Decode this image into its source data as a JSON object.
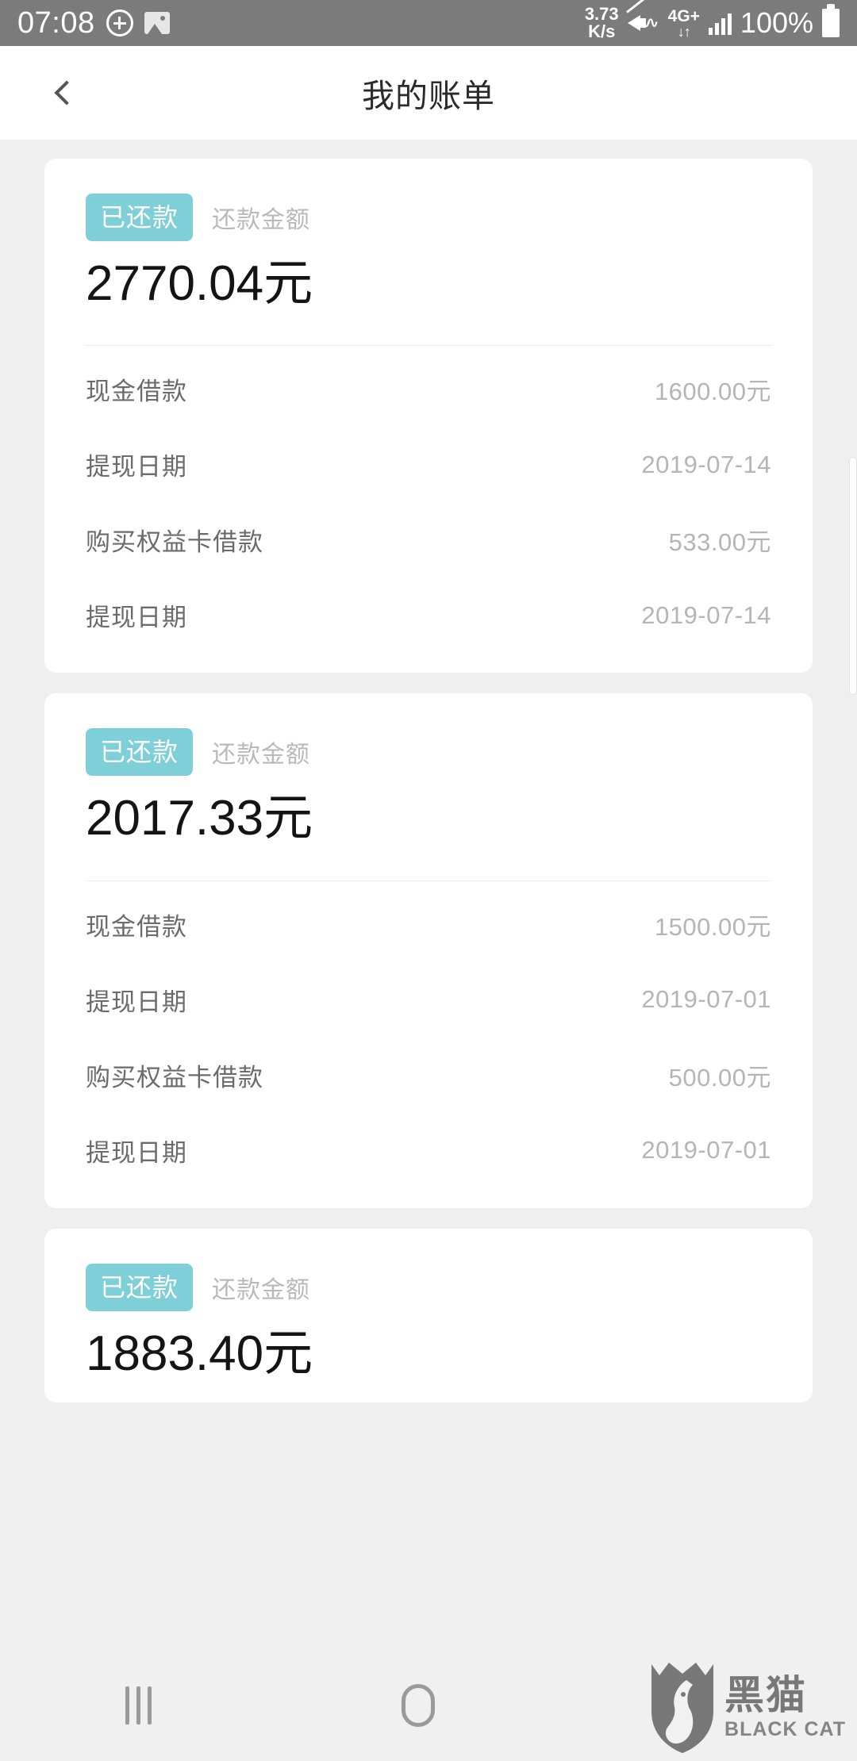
{
  "status_bar": {
    "clock": "07:08",
    "icons_left": [
      "plus-circle-icon",
      "photo-icon"
    ],
    "net_speed_value": "3.73",
    "net_speed_unit": "K/s",
    "mute_icon": "mute-vibrate-icon",
    "network_type": "4G+",
    "network_arrows": "↓↑",
    "signal_icon": "signal-bars-icon",
    "battery_percent": "100%",
    "battery_icon": "battery-full-icon",
    "background_color": "#7b7b7b"
  },
  "app_bar": {
    "back_icon": "chevron-left-icon",
    "title": "我的账单"
  },
  "theme": {
    "badge_color": "#7ecfd8",
    "page_background": "#efefef",
    "card_background": "#ffffff",
    "amount_color": "#141414",
    "label_color": "#6b6b6b",
    "value_color": "#b5b5b5"
  },
  "bills": [
    {
      "status_badge": "已还款",
      "amount_label": "还款金额",
      "amount": "2770.04元",
      "rows": [
        {
          "label": "现金借款",
          "value": "1600.00元"
        },
        {
          "label": "提现日期",
          "value": "2019-07-14"
        },
        {
          "label": "购买权益卡借款",
          "value": "533.00元"
        },
        {
          "label": "提现日期",
          "value": "2019-07-14"
        }
      ]
    },
    {
      "status_badge": "已还款",
      "amount_label": "还款金额",
      "amount": "2017.33元",
      "rows": [
        {
          "label": "现金借款",
          "value": "1500.00元"
        },
        {
          "label": "提现日期",
          "value": "2019-07-01"
        },
        {
          "label": "购买权益卡借款",
          "value": "500.00元"
        },
        {
          "label": "提现日期",
          "value": "2019-07-01"
        }
      ]
    },
    {
      "status_badge": "已还款",
      "amount_label": "还款金额",
      "amount": "1883.40元",
      "rows": []
    }
  ],
  "nav_bar": {
    "recent_icon": "recent-apps-icon",
    "home_icon": "home-icon",
    "back_icon": "nav-back-icon"
  },
  "watermark": {
    "shield_icon": "black-cat-shield-icon",
    "cn_text": "黑猫",
    "en_text": "BLACK CAT"
  }
}
